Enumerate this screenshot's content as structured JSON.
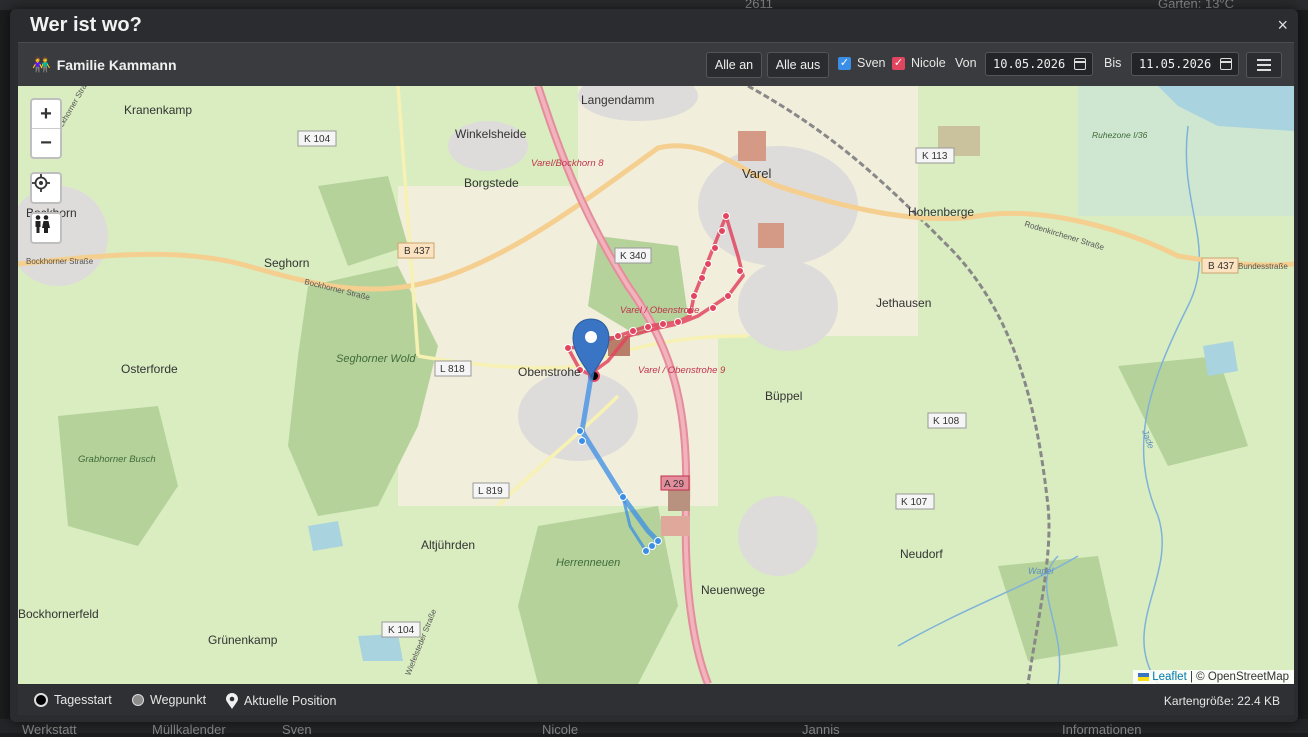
{
  "dialog": {
    "title": "Wer ist wo?",
    "close_symbol": "×"
  },
  "background": {
    "top_text_1": "2611",
    "top_text_2": "Garten: 13°C",
    "bottom_texts": [
      "Werkstatt",
      "Müllkalender",
      "Sven",
      "Nicole",
      "Jannis",
      "Informationen"
    ]
  },
  "toolbar": {
    "family_icon": "family-icon",
    "family_name": "Familie Kammann",
    "all_on_label": "Alle an",
    "all_off_label": "Alle aus",
    "persons": [
      {
        "name": "Sven",
        "checked": true,
        "color": "#3a8ee6"
      },
      {
        "name": "Nicole",
        "checked": true,
        "color": "#e2455f"
      }
    ],
    "from_label": "Von",
    "from_date": "10.05.2026",
    "to_label": "Bis",
    "to_date": "11.05.2026",
    "menu_icon": "hamburger-icon"
  },
  "map": {
    "zoom_in": "+",
    "zoom_out": "−",
    "places": [
      "Langendamm",
      "Kranenkamp",
      "Winkelsheide",
      "Varel",
      "Borgstede",
      "Hohenberge",
      "Seghorn",
      "Bockhorn",
      "Jethausen",
      "Osterforde",
      "Obenstrohe",
      "Büppel",
      "Altjührden",
      "Neudorf",
      "Neuenwege",
      "Grünenkamp",
      "Bockhornerfeld",
      "Seghorner Wold",
      "Grabhorner Busch",
      "Herrenneuen",
      "Ruhezone I/36"
    ],
    "roads": [
      "K 104",
      "K 113",
      "B 437",
      "K 340",
      "L 818",
      "K 108",
      "L 819",
      "K 107",
      "A 29",
      "K 104",
      "B 437"
    ],
    "streets": [
      "Bockhorner Straße",
      "Bockhorner Straße",
      "Rodenkirchener Straße",
      "Bundesstraße",
      "Wiefelsteder Straße",
      "Bockhorner Straße"
    ],
    "junctions": [
      "Varel/Bockhorn 8",
      "Varel / Obenstrohe",
      "Varel / Obenstrohe 9"
    ],
    "water_labels": [
      "Wapel",
      "Jade"
    ],
    "attribution_leaflet": "Leaflet",
    "attribution_sep": " | © ",
    "attribution_osm": "OpenStreetMap"
  },
  "legend": {
    "day_start": "Tagesstart",
    "waypoint": "Wegpunkt",
    "current_position": "Aktuelle Position",
    "map_size": "Kartengröße: 22.4 KB"
  },
  "colors": {
    "sven_track": "#3a8ee6",
    "nicole_track": "#e2455f",
    "dialog_bg": "#2b2c2f"
  }
}
